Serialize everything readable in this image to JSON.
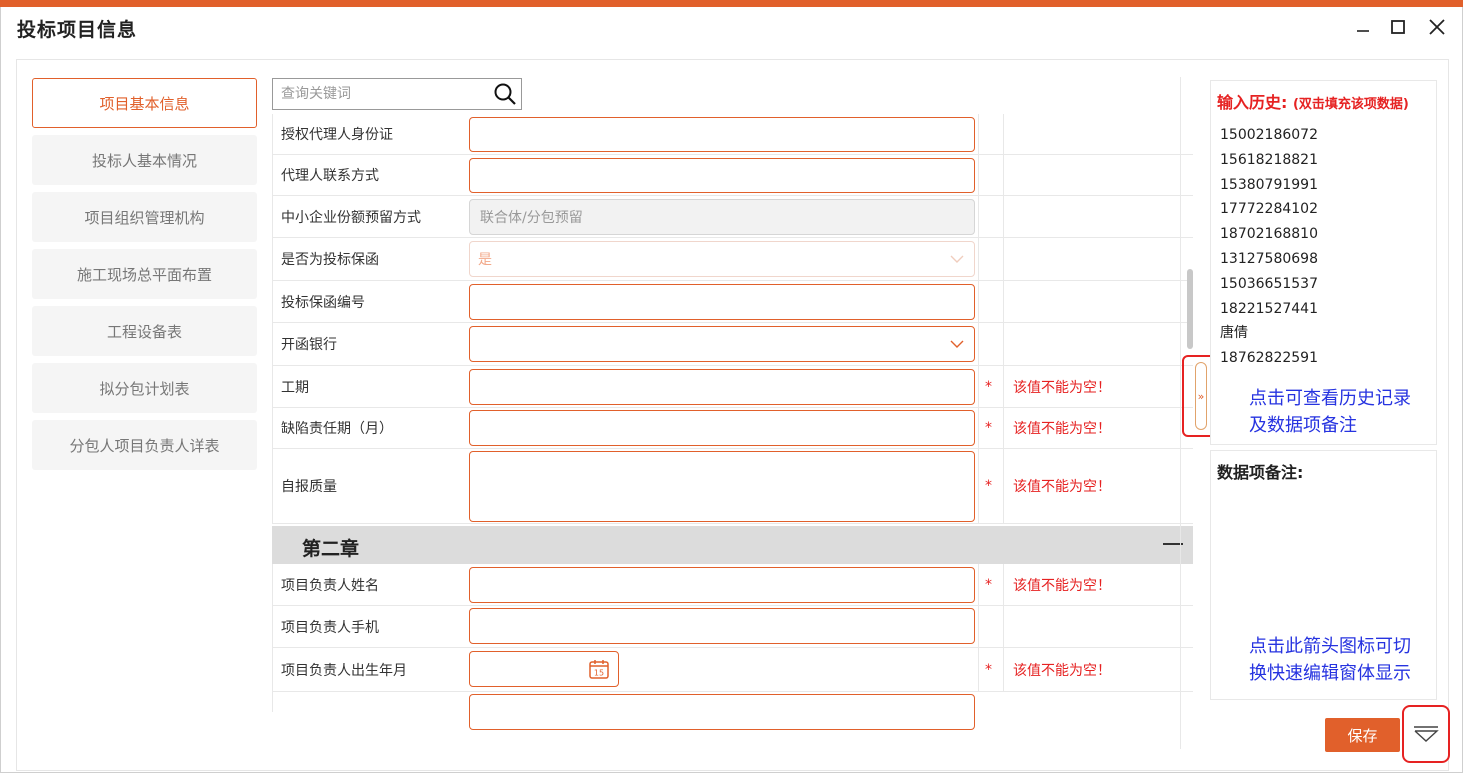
{
  "window": {
    "title": "投标项目信息",
    "accent": "#e1602b",
    "error_color": "#e62222"
  },
  "nav": {
    "items": [
      {
        "label": "项目基本信息",
        "active": true
      },
      {
        "label": "投标人基本情况"
      },
      {
        "label": "项目组织管理机构"
      },
      {
        "label": "施工现场总平面布置"
      },
      {
        "label": "工程设备表"
      },
      {
        "label": "拟分包计划表"
      },
      {
        "label": "分包人项目负责人详表"
      }
    ]
  },
  "search": {
    "placeholder": "查询关键词",
    "icon": "search-icon"
  },
  "form": {
    "rows": [
      {
        "label": "授权代理人身份证",
        "value": ""
      },
      {
        "label": "代理人联系方式",
        "value": ""
      },
      {
        "label": "中小企业份额预留方式",
        "value": "联合体/分包预留"
      },
      {
        "label": "是否为投标保函",
        "value": "是"
      },
      {
        "label": "投标保函编号",
        "value": ""
      },
      {
        "label": "开函银行",
        "value": ""
      },
      {
        "label": "工期",
        "required": "*",
        "error": "该值不能为空！"
      },
      {
        "label": "缺陷责任期（月）",
        "required": "*",
        "error": "该值不能为空！"
      },
      {
        "label": "自报质量",
        "required": "*",
        "error": "该值不能为空！"
      }
    ],
    "chapter": {
      "title": "第二章",
      "toggle": "—"
    },
    "rows2": [
      {
        "label": "项目负责人姓名",
        "required": "*",
        "error": "该值不能为空！"
      },
      {
        "label": "项目负责人手机"
      },
      {
        "label": "项目负责人出生年月",
        "required": "*",
        "error": "该值不能为空！",
        "date_icon_day": "15"
      }
    ]
  },
  "toggle_tab": {
    "glyph": "»"
  },
  "history": {
    "title": "输入历史:",
    "subtitle": "(双击填充该项数据)",
    "items": [
      "15002186072",
      "15618218821",
      "15380791991",
      "17772284102",
      "18702168810",
      "13127580698",
      "15036651537",
      "18221527441",
      "唐倩",
      "18762822591"
    ]
  },
  "notes": {
    "title": "数据项备注:"
  },
  "annotations": {
    "a1_l1": "点击可查看历史记录",
    "a1_l2": "及数据项备注",
    "a2_l1": "点击此箭头图标可切",
    "a2_l2": "换快速编辑窗体显示"
  },
  "footer": {
    "save_label": "保存"
  }
}
